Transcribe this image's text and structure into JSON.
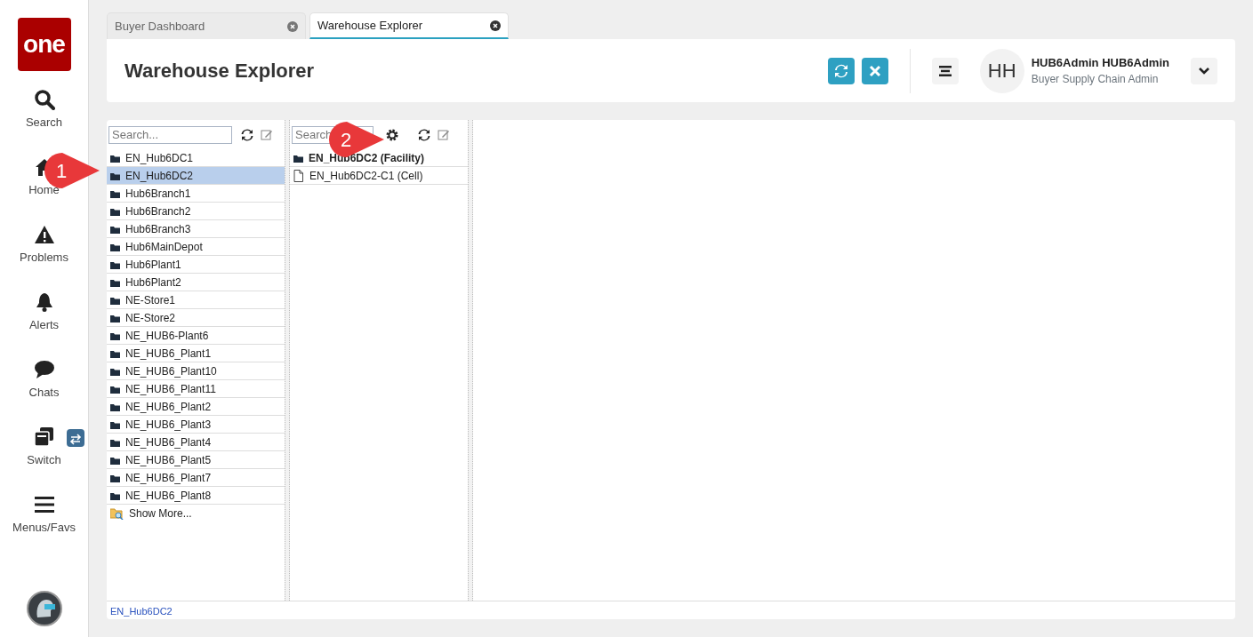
{
  "nav": {
    "logo": "one",
    "items": [
      {
        "kind": "search",
        "label": "Search"
      },
      {
        "kind": "home",
        "label": "Home"
      },
      {
        "kind": "problems",
        "label": "Problems"
      },
      {
        "kind": "alerts",
        "label": "Alerts"
      },
      {
        "kind": "chats",
        "label": "Chats"
      },
      {
        "kind": "switch",
        "label": "Switch"
      },
      {
        "kind": "menus",
        "label": "Menus/Favs"
      }
    ]
  },
  "tabs": [
    {
      "label": "Buyer Dashboard",
      "selected": false
    },
    {
      "label": "Warehouse Explorer",
      "selected": true
    }
  ],
  "header": {
    "title": "Warehouse Explorer",
    "user": {
      "initials": "HH",
      "name": "HUB6Admin HUB6Admin",
      "role": "Buyer Supply Chain Admin"
    }
  },
  "left_tree": {
    "search": {
      "placeholder": "Search..."
    },
    "items": [
      {
        "label": "EN_Hub6DC1",
        "selected": false
      },
      {
        "label": "EN_Hub6DC2",
        "selected": true
      },
      {
        "label": "Hub6Branch1",
        "selected": false
      },
      {
        "label": "Hub6Branch2",
        "selected": false
      },
      {
        "label": "Hub6Branch3",
        "selected": false
      },
      {
        "label": "Hub6MainDepot",
        "selected": false
      },
      {
        "label": "Hub6Plant1",
        "selected": false
      },
      {
        "label": "Hub6Plant2",
        "selected": false
      },
      {
        "label": "NE-Store1",
        "selected": false
      },
      {
        "label": "NE-Store2",
        "selected": false
      },
      {
        "label": "NE_HUB6-Plant6",
        "selected": false
      },
      {
        "label": "NE_HUB6_Plant1",
        "selected": false
      },
      {
        "label": "NE_HUB6_Plant10",
        "selected": false
      },
      {
        "label": "NE_HUB6_Plant11",
        "selected": false
      },
      {
        "label": "NE_HUB6_Plant2",
        "selected": false
      },
      {
        "label": "NE_HUB6_Plant3",
        "selected": false
      },
      {
        "label": "NE_HUB6_Plant4",
        "selected": false
      },
      {
        "label": "NE_HUB6_Plant5",
        "selected": false
      },
      {
        "label": "NE_HUB6_Plant7",
        "selected": false
      },
      {
        "label": "NE_HUB6_Plant8",
        "selected": false
      }
    ],
    "show_more": "Show More..."
  },
  "right_tree": {
    "search": {
      "placeholder": "Search"
    },
    "items": [
      {
        "label": "EN_Hub6DC2 (Facility)",
        "kind": "facility"
      },
      {
        "label": "EN_Hub6DC2-C1 (Cell)",
        "kind": "cell"
      }
    ]
  },
  "status_bar": {
    "path": "EN_Hub6DC2"
  },
  "callouts": [
    "1",
    "2"
  ]
}
